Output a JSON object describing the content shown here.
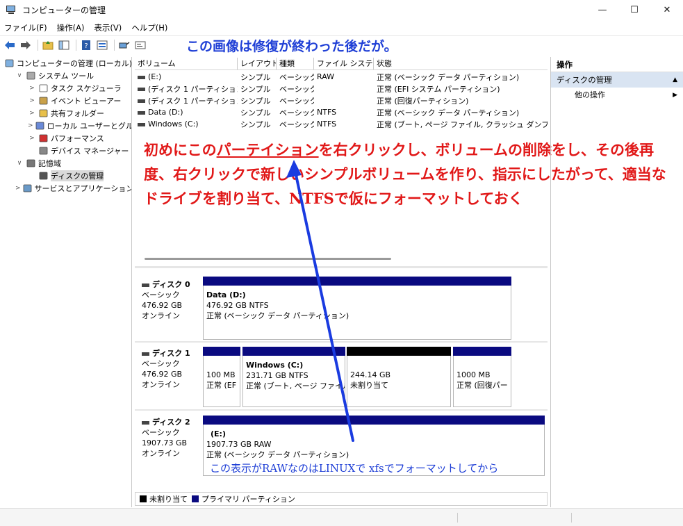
{
  "window": {
    "title": "コンピューターの管理",
    "minimize_glyph": "—",
    "maximize_glyph": "☐",
    "close_glyph": "✕"
  },
  "menu": [
    "ファイル(F)",
    "操作(A)",
    "表示(V)",
    "ヘルプ(H)"
  ],
  "toolbar": {
    "icons": [
      "back-arrow-icon",
      "forward-arrow-icon",
      "up-folder-icon",
      "show-hide-tree-icon",
      "help-icon",
      "properties-icon",
      "connect-icon",
      "console-icon"
    ]
  },
  "annotation_top": "この画像は修復が終わった後だが。",
  "tree": [
    {
      "label": "コンピューターの管理 (ローカル)",
      "level": 0,
      "twisty": "",
      "icon": "computer-icon"
    },
    {
      "label": "システム ツール",
      "level": 1,
      "twisty": "∨",
      "icon": "tools-icon"
    },
    {
      "label": "タスク スケジューラ",
      "level": 2,
      "twisty": ">",
      "icon": "clock-icon"
    },
    {
      "label": "イベント ビューアー",
      "level": 2,
      "twisty": ">",
      "icon": "event-viewer-icon"
    },
    {
      "label": "共有フォルダー",
      "level": 2,
      "twisty": ">",
      "icon": "shared-folder-icon"
    },
    {
      "label": "ローカル ユーザーとグループ",
      "level": 2,
      "twisty": ">",
      "icon": "users-icon"
    },
    {
      "label": "パフォーマンス",
      "level": 2,
      "twisty": ">",
      "icon": "performance-icon"
    },
    {
      "label": "デバイス マネージャー",
      "level": 2,
      "twisty": "",
      "icon": "device-manager-icon"
    },
    {
      "label": "記憶域",
      "level": 1,
      "twisty": "∨",
      "icon": "storage-icon"
    },
    {
      "label": "ディスクの管理",
      "level": 2,
      "twisty": "",
      "icon": "disk-icon",
      "selected": true
    },
    {
      "label": "サービスとアプリケーション",
      "level": 1,
      "twisty": ">",
      "icon": "services-icon"
    }
  ],
  "volume_columns": [
    "ボリューム",
    "レイアウト",
    "種類",
    "ファイル システム",
    "状態"
  ],
  "volumes": [
    {
      "name": "(E:)",
      "layout": "シンプル",
      "type": "ベーシック",
      "fs": "RAW",
      "status": "正常 (ベーシック データ パーティション)"
    },
    {
      "name": "(ディスク 1 パーティション 1)",
      "layout": "シンプル",
      "type": "ベーシック",
      "fs": "",
      "status": "正常 (EFI システム パーティション)"
    },
    {
      "name": "(ディスク 1 パーティション 4)",
      "layout": "シンプル",
      "type": "ベーシック",
      "fs": "",
      "status": "正常 (回復パーティション)"
    },
    {
      "name": "Data (D:)",
      "layout": "シンプル",
      "type": "ベーシック",
      "fs": "NTFS",
      "status": "正常 (ベーシック データ パーティション)"
    },
    {
      "name": "Windows (C:)",
      "layout": "シンプル",
      "type": "ベーシック",
      "fs": "NTFS",
      "status": "正常 (ブート, ページ ファイル, クラッシュ ダンプ, ベーシ"
    }
  ],
  "annotation_red": {
    "part1": "初めにこの",
    "part2": "パーテイション",
    "part3": "を右クリックし、ボリュームの削除をし、その後再度、右クリックで新しいシンプルボリュームを作り、指示にしたがって、適当なドライブを割り当て、NTFSで仮にフォーマットしておく"
  },
  "disks": [
    {
      "name": "ディスク 0",
      "kind": "ベーシック",
      "size": "476.92 GB",
      "state": "オンライン",
      "partitions": [
        {
          "title": "Data  (D:)",
          "line1": "476.92 GB NTFS",
          "line2": "正常 (ベーシック データ パーティション)"
        }
      ]
    },
    {
      "name": "ディスク 1",
      "kind": "ベーシック",
      "size": "476.92 GB",
      "state": "オンライン",
      "partitions": [
        {
          "title": "",
          "line1": "100 MB",
          "line2": "正常 (EF"
        },
        {
          "title": "Windows  (C:)",
          "line1": "231.71 GB NTFS",
          "line2": "正常 (ブート, ページ ファイル,"
        },
        {
          "title": "",
          "line1": "244.14 GB",
          "line2": "未割り当て"
        },
        {
          "title": "",
          "line1": "1000 MB",
          "line2": "正常 (回復パー"
        }
      ]
    },
    {
      "name": "ディスク 2",
      "kind": "ベーシック",
      "size": "1907.73 GB",
      "state": "オンライン",
      "partitions": [
        {
          "title": "(E:)",
          "line1": "1907.73 GB RAW",
          "line2": "正常 (ベーシック データ パーティション)"
        }
      ]
    }
  ],
  "annotation_bottom": "この表示がRAWなのはLINUXで xfsでフォーマットしてから",
  "legend": {
    "unallocated": "未割り当て",
    "primary": "プライマリ パーティション"
  },
  "colors": {
    "primary_partition": "#0a0a80",
    "unallocated": "#000000",
    "annotation_red": "#e11818",
    "annotation_blue": "#1f3fd6",
    "arrow": "#1a3be0"
  },
  "actions": {
    "header": "操作",
    "selected": "ディスクの管理",
    "item": "他の操作"
  }
}
